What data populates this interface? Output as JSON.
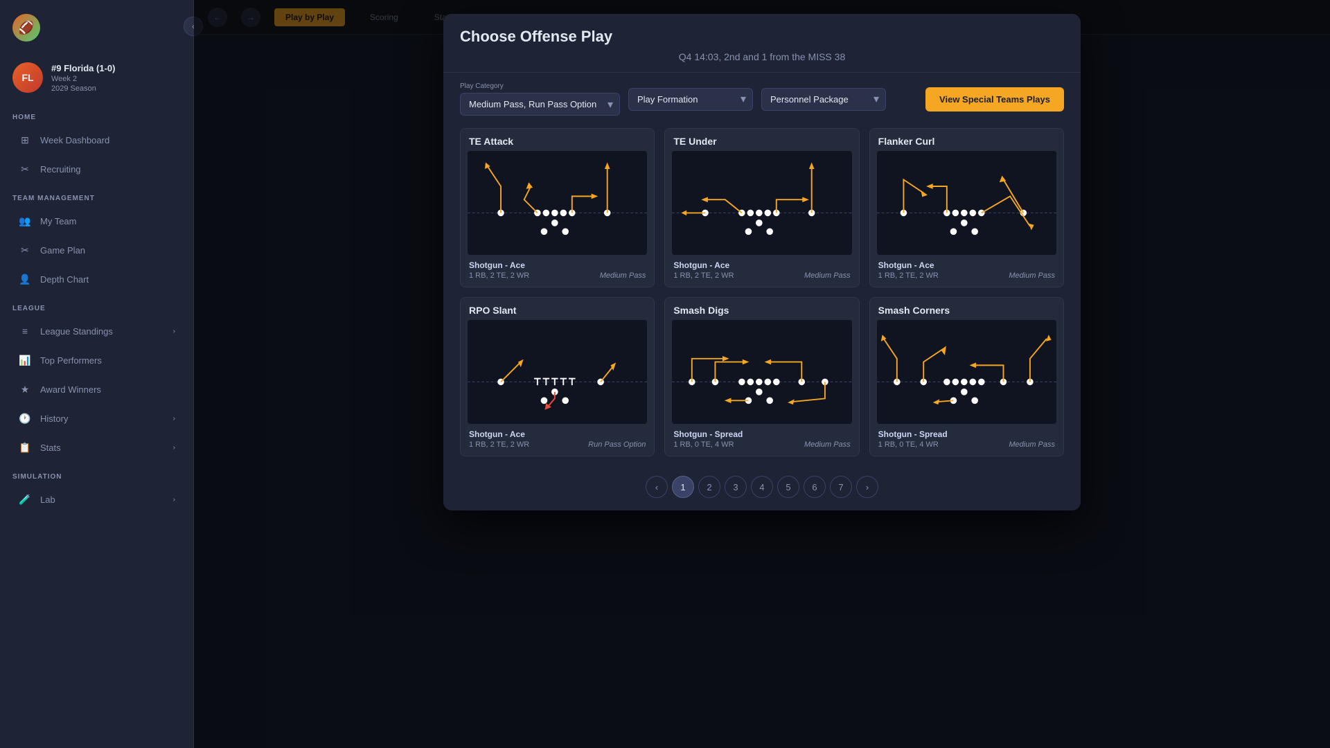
{
  "sidebar": {
    "logo_text": "🏈",
    "collapse_icon": "‹",
    "team": {
      "avatar": "FL",
      "name": "#9 Florida (1-0)",
      "week": "Week 2",
      "season": "2029 Season"
    },
    "sections": [
      {
        "label": "HOME",
        "items": [
          {
            "id": "week-dashboard",
            "label": "Week Dashboard",
            "icon": "⊞",
            "has_chevron": false
          },
          {
            "id": "recruiting",
            "label": "Recruiting",
            "icon": "✂",
            "has_chevron": false
          }
        ]
      },
      {
        "label": "TEAM MANAGEMENT",
        "items": [
          {
            "id": "my-team",
            "label": "My Team",
            "icon": "👥",
            "has_chevron": false
          },
          {
            "id": "game-plan",
            "label": "Game Plan",
            "icon": "✂",
            "has_chevron": false
          },
          {
            "id": "depth-chart",
            "label": "Depth Chart",
            "icon": "👤",
            "has_chevron": false
          }
        ]
      },
      {
        "label": "LEAGUE",
        "items": [
          {
            "id": "league-standings",
            "label": "League Standings",
            "icon": "≡",
            "has_chevron": true
          },
          {
            "id": "top-performers",
            "label": "Top Performers",
            "icon": "📊",
            "has_chevron": false
          },
          {
            "id": "award-winners",
            "label": "Award Winners",
            "icon": "★",
            "has_chevron": false
          },
          {
            "id": "history",
            "label": "History",
            "icon": "🕐",
            "has_chevron": true
          },
          {
            "id": "stats",
            "label": "Stats",
            "icon": "📋",
            "has_chevron": true
          }
        ]
      },
      {
        "label": "SIMULATION",
        "items": [
          {
            "id": "lab",
            "label": "Lab",
            "icon": "🧪",
            "has_chevron": true
          }
        ]
      }
    ]
  },
  "modal": {
    "title": "Choose Offense Play",
    "subtitle": "Q4 14:03, 2nd and 1 from the MISS 38",
    "filters": {
      "play_category_label": "Play Category",
      "play_category_value": "Medium Pass, Run Pass Option",
      "play_formation_label": "",
      "play_formation_placeholder": "Play Formation",
      "personnel_package_placeholder": "Personnel Package",
      "special_teams_btn": "View Special Teams Plays"
    },
    "plays": [
      {
        "id": "te-attack",
        "title": "TE Attack",
        "formation": "Shotgun - Ace",
        "personnel": "1 RB, 2 TE, 2 WR",
        "type": "Medium Pass",
        "diagram_type": "te_attack"
      },
      {
        "id": "te-under",
        "title": "TE Under",
        "formation": "Shotgun - Ace",
        "personnel": "1 RB, 2 TE, 2 WR",
        "type": "Medium Pass",
        "diagram_type": "te_under"
      },
      {
        "id": "flanker-curl",
        "title": "Flanker Curl",
        "formation": "Shotgun - Ace",
        "personnel": "1 RB, 2 TE, 2 WR",
        "type": "Medium Pass",
        "diagram_type": "flanker_curl"
      },
      {
        "id": "rpo-slant",
        "title": "RPO Slant",
        "formation": "Shotgun - Ace",
        "personnel": "1 RB, 2 TE, 2 WR",
        "type": "Run Pass Option",
        "diagram_type": "rpo_slant"
      },
      {
        "id": "smash-digs",
        "title": "Smash Digs",
        "formation": "Shotgun - Spread",
        "personnel": "1 RB, 0 TE, 4 WR",
        "type": "Medium Pass",
        "diagram_type": "smash_digs"
      },
      {
        "id": "smash-corners",
        "title": "Smash Corners",
        "formation": "Shotgun - Spread",
        "personnel": "1 RB, 0 TE, 4 WR",
        "type": "Medium Pass",
        "diagram_type": "smash_corners"
      }
    ],
    "pagination": {
      "current_page": 1,
      "total_pages": 7,
      "pages": [
        1,
        2,
        3,
        4,
        5,
        6,
        7
      ],
      "prev_icon": "‹",
      "next_icon": "›"
    }
  },
  "game_tabs": [
    "Play by Play",
    "Scoring",
    "Stats"
  ],
  "active_tab_index": 0
}
